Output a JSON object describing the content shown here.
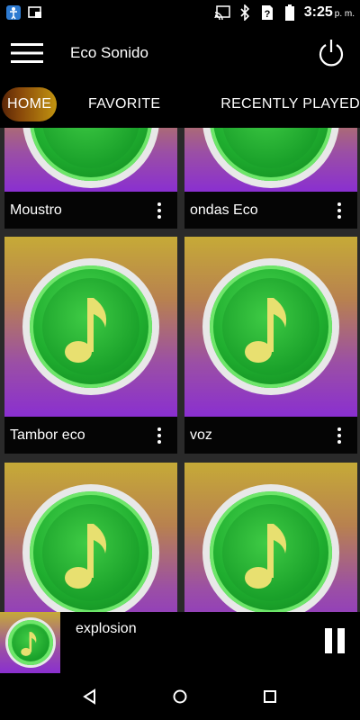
{
  "status_bar": {
    "time": "3:25",
    "ampm": "p. m.",
    "icons_left": [
      "accessibility-icon",
      "cast-screen-icon"
    ],
    "icons_right": [
      "cast-icon",
      "bluetooth-icon",
      "no-sim-icon",
      "battery-icon"
    ]
  },
  "app_bar": {
    "title": "Eco Sonido",
    "menu_icon": "hamburger-menu-icon",
    "power_icon": "power-icon"
  },
  "tabs": [
    {
      "label": "HOME",
      "active": true
    },
    {
      "label": "FAVORITE",
      "active": false
    },
    {
      "label": "RECENTLY PLAYED",
      "active": false
    }
  ],
  "grid": {
    "items": [
      {
        "title": "Moustro"
      },
      {
        "title": "ondas Eco"
      },
      {
        "title": "Tambor eco"
      },
      {
        "title": "voz"
      },
      {
        "title": ""
      },
      {
        "title": ""
      }
    ]
  },
  "now_playing": {
    "title": "explosion",
    "state": "playing"
  },
  "colors": {
    "accent_gradient_start": "#5a2507",
    "accent_gradient_end": "#c29410",
    "disc_green": "#1fae2f",
    "note_yellow": "#e8e070",
    "card_top": "#c6aa37",
    "card_bottom": "#8a2fd0"
  }
}
